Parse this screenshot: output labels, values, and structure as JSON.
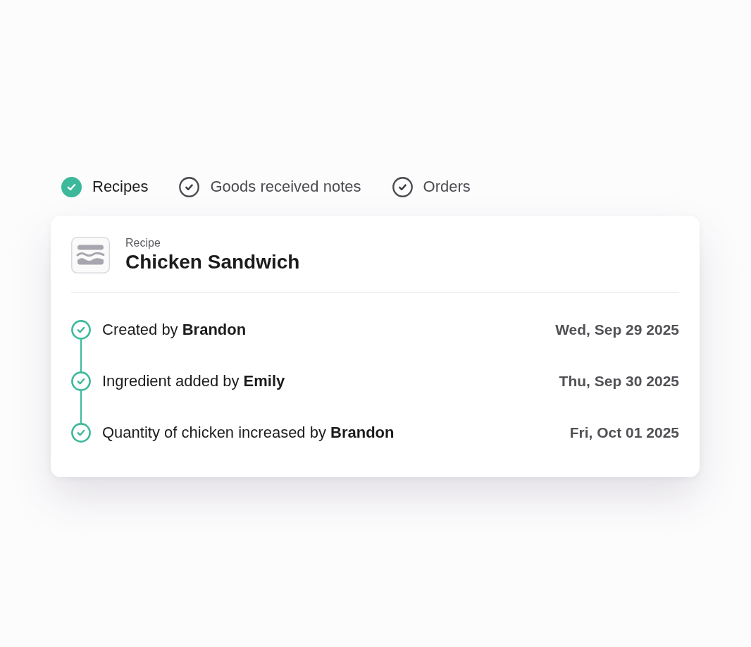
{
  "tabs": [
    {
      "label": "Recipes",
      "selected": true
    },
    {
      "label": "Goods received notes",
      "selected": false
    },
    {
      "label": "Orders",
      "selected": false
    }
  ],
  "record": {
    "type": "Recipe",
    "title": "Chicken Sandwich",
    "history": [
      {
        "text": "Created by **Brandon**",
        "date": "Wed, Sep 29 2025"
      },
      {
        "text": "Ingredient added by **Emily**",
        "date": "Thu, Sep 30 2025"
      },
      {
        "text": "Quantity of chicken increased by **Brandon**",
        "date": "Fri, Oct 01 2025"
      }
    ]
  }
}
